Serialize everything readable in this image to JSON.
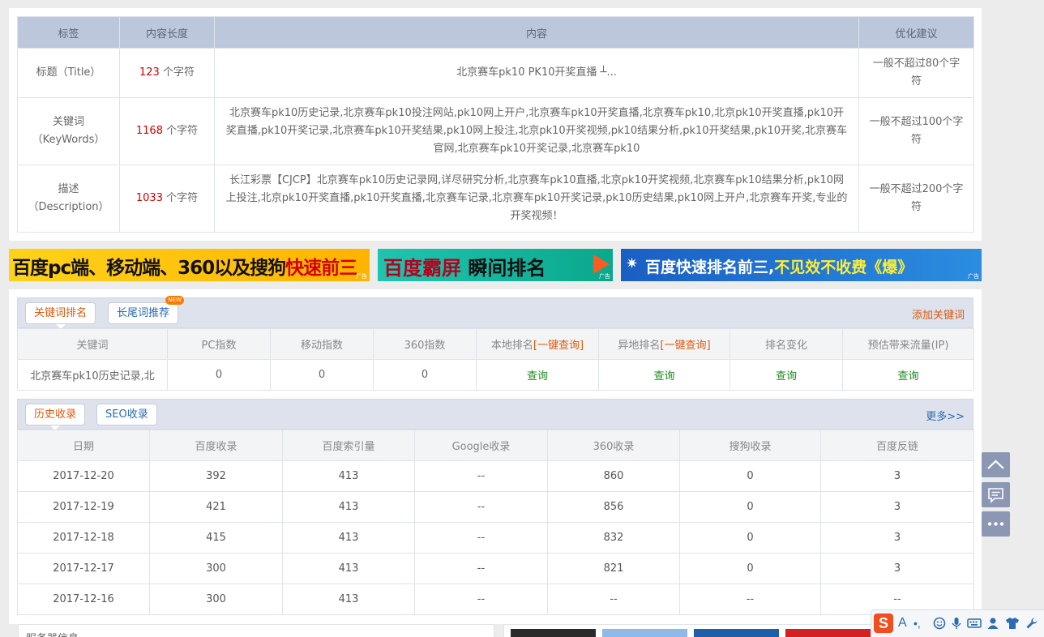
{
  "meta": {
    "headers": [
      "标签",
      "内容长度",
      "内容",
      "优化建议"
    ],
    "unit": "个字符",
    "rows": [
      {
        "label": "标题（Title）",
        "length": "123",
        "content": "北京赛车pk10 PK10开奖直播 ┴...",
        "advice": "一般不超过80个字符"
      },
      {
        "label": "关键词（KeyWords）",
        "length": "1168",
        "content": "北京赛车pk10历史记录,北京赛车pk10投注网站,pk10网上开户,北京赛车pk10开奖直播,北京赛车pk10,北京pk10开奖直播,pk10开奖直播,pk10开奖记录,北京赛车pk10开奖结果,pk10网上投注,北京pk10开奖视频,pk10结果分析,pk10开奖结果,pk10开奖,北京赛车官网,北京赛车pk10开奖记录,北京赛车pk10",
        "advice": "一般不超过100个字符"
      },
      {
        "label": "描述（Description）",
        "length": "1033",
        "content": "长江彩票【CJCP】北京赛车pk10历史记录网,详尽研究分析,北京赛车pk10直播,北京pk10开奖视频,北京赛车pk10结果分析,pk10网上投注,北京pk10开奖直播,pk10开奖直播,北京赛车记录,北京赛车pk10开奖记录,pk10历史结果,pk10网上开户,北京赛车开奖,专业的开奖视频！",
        "advice": "一般不超过200个字符"
      }
    ]
  },
  "banners": {
    "b1_part1": "百度pc端、移动端、360以及搜狗",
    "b1_part2": "快速前三",
    "b2_part1": "百度霸屏",
    "b2_part2": "瞬间排名",
    "b3_part1": "百度快速排名前三,",
    "b3_part2": "不见效不收费",
    "b3_part3": "《爆》",
    "ad_label": "广告"
  },
  "keyword_tabs": {
    "tab1": "关键词排名",
    "tab2": "长尾词推荐",
    "new_badge": "NEW",
    "add_link": "添加关键词"
  },
  "keyword_table": {
    "headers": [
      "关键词",
      "PC指数",
      "移动指数",
      "360指数",
      "本地排名",
      "异地排名",
      "排名变化",
      "预估带来流量(IP)"
    ],
    "query_all": "[一键查询]",
    "row": {
      "keyword": "北京赛车pk10历史记录,北",
      "pc": "0",
      "mobile": "0",
      "s360": "0",
      "local": "查询",
      "remote": "查询",
      "change": "查询",
      "traffic": "查询"
    }
  },
  "history_tabs": {
    "tab1": "历史收录",
    "tab2": "SEO收录",
    "more_link": "更多>>"
  },
  "history_table": {
    "headers": [
      "日期",
      "百度收录",
      "百度索引量",
      "Google收录",
      "360收录",
      "搜狗收录",
      "百度反链"
    ],
    "rows": [
      [
        "2017-12-20",
        "392",
        "413",
        "--",
        "860",
        "0",
        "3"
      ],
      [
        "2017-12-19",
        "421",
        "413",
        "--",
        "856",
        "0",
        "3"
      ],
      [
        "2017-12-18",
        "415",
        "413",
        "--",
        "832",
        "0",
        "3"
      ],
      [
        "2017-12-17",
        "300",
        "413",
        "--",
        "821",
        "0",
        "3"
      ],
      [
        "2017-12-16",
        "300",
        "413",
        "--",
        "--",
        "--",
        "--"
      ]
    ]
  },
  "bottom": {
    "server_info_label": "服务器信息"
  },
  "ime": {
    "logo": "S",
    "lang": "A",
    "punct": "•,"
  }
}
